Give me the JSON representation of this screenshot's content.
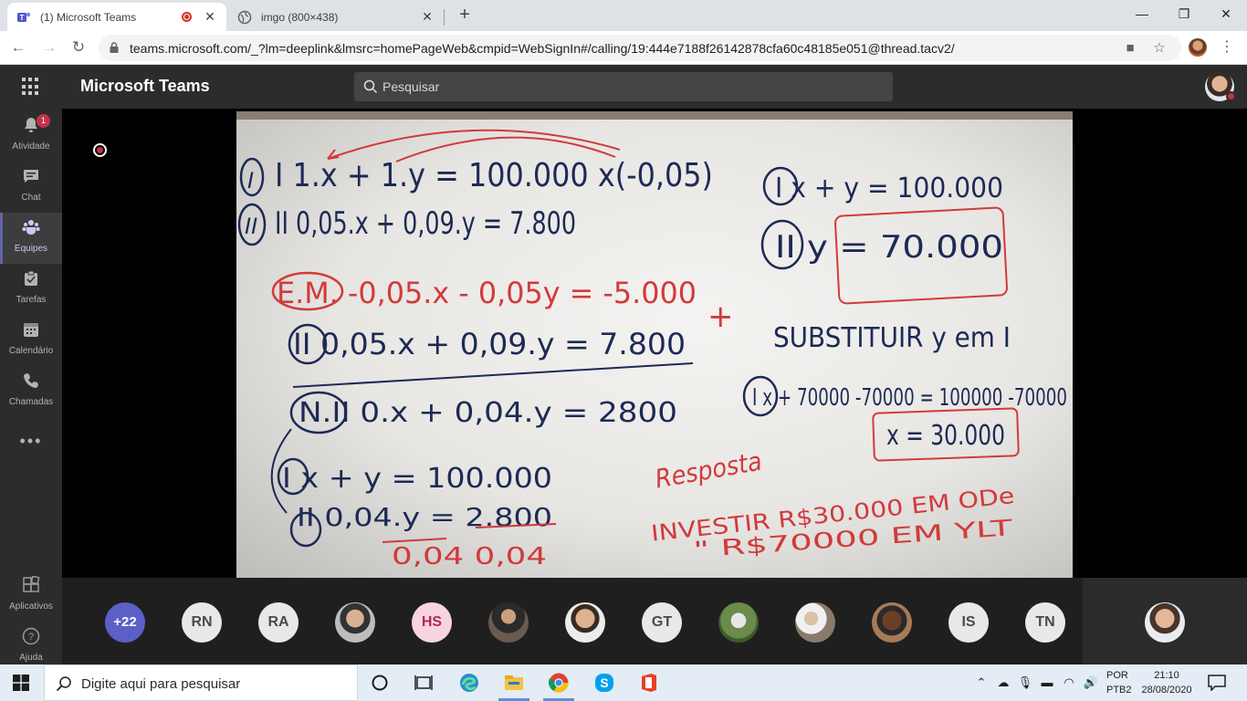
{
  "browser": {
    "tabs": [
      {
        "title": "(1) Microsoft Teams",
        "active": true
      },
      {
        "title": "imgo (800×438)",
        "active": false
      }
    ],
    "url": "teams.microsoft.com/_?lm=deeplink&lmsrc=homePageWeb&cmpid=WebSignIn#/calling/19:444e7188f26142878cfa60c48185e051@thread.tacv2/"
  },
  "teams": {
    "app_title": "Microsoft Teams",
    "search_placeholder": "Pesquisar",
    "rail": [
      {
        "label": "Atividade",
        "icon": "bell-icon",
        "badge": "1"
      },
      {
        "label": "Chat",
        "icon": "chat-icon"
      },
      {
        "label": "Equipes",
        "icon": "teams-icon",
        "active": true
      },
      {
        "label": "Tarefas",
        "icon": "tasks-icon"
      },
      {
        "label": "Calendário",
        "icon": "calendar-icon"
      },
      {
        "label": "Chamadas",
        "icon": "phone-icon"
      }
    ],
    "rail_bottom": [
      {
        "label": "Aplicativos",
        "icon": "apps-icon"
      },
      {
        "label": "Ajuda",
        "icon": "help-icon"
      }
    ]
  },
  "call": {
    "participants": [
      {
        "kind": "more",
        "text": "+22"
      },
      {
        "kind": "initials",
        "text": "RN"
      },
      {
        "kind": "initials",
        "text": "RA"
      },
      {
        "kind": "photo",
        "text": ""
      },
      {
        "kind": "initials",
        "text": "HS"
      },
      {
        "kind": "photo",
        "text": ""
      },
      {
        "kind": "photo",
        "text": ""
      },
      {
        "kind": "initials",
        "text": "GT"
      },
      {
        "kind": "photo",
        "text": ""
      },
      {
        "kind": "photo",
        "text": ""
      },
      {
        "kind": "photo",
        "text": ""
      },
      {
        "kind": "initials",
        "text": "IS"
      },
      {
        "kind": "initials",
        "text": "TN"
      }
    ],
    "whiteboard": {
      "lines": [
        "I  1.x + 1.y = 100.000   x(-0,05)",
        "II  0,05.x + 0,09.y = 7.800",
        "E.M.  -0,05.x - 0,05y = -5.000",
        "II  0,05.x + 0,09.y = 7.800",
        "N.II  0.x + 0,04.y = 2800",
        "I  x + y = 100.000",
        "II  0,04.y = 2.800",
        "0,04      0,04",
        "I  x + y = 100.000",
        "II  y = 70.000",
        "SUBSTITUIR y em I",
        "I  x + 70000 -70000 = 100000 -70000",
        "x = 30.000",
        "Resposta",
        "INVESTIR  R$30.000 EM ODe",
        "\"  R$70000 EM YLT"
      ]
    }
  },
  "taskbar": {
    "search_text": "Digite aqui para pesquisar",
    "lang_1": "POR",
    "lang_2": "PTB2",
    "time": "21:10",
    "date": "28/08/2020"
  }
}
